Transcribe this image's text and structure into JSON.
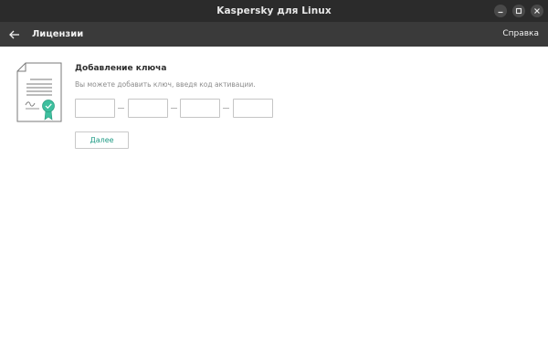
{
  "window": {
    "title": "Kaspersky для Linux"
  },
  "appbar": {
    "heading": "Лицензии",
    "help_label": "Справка"
  },
  "add_key": {
    "title": "Добавление ключа",
    "hint": "Вы можете добавить ключ, введя код активации.",
    "fields": [
      {
        "value": "",
        "placeholder": ""
      },
      {
        "value": "",
        "placeholder": ""
      },
      {
        "value": "",
        "placeholder": ""
      },
      {
        "value": "",
        "placeholder": ""
      }
    ],
    "next_label": "Далее"
  },
  "colors": {
    "titlebar_bg": "#2b2b2b",
    "appbar_bg": "#3a3a3a",
    "accent_green": "#1f9b85",
    "badge_green": "#3dbf9e"
  },
  "icons": {
    "back": "arrow-left-icon",
    "minimize": "minimize-icon",
    "maximize": "maximize-icon",
    "close": "close-icon",
    "document": "license-document-icon"
  }
}
